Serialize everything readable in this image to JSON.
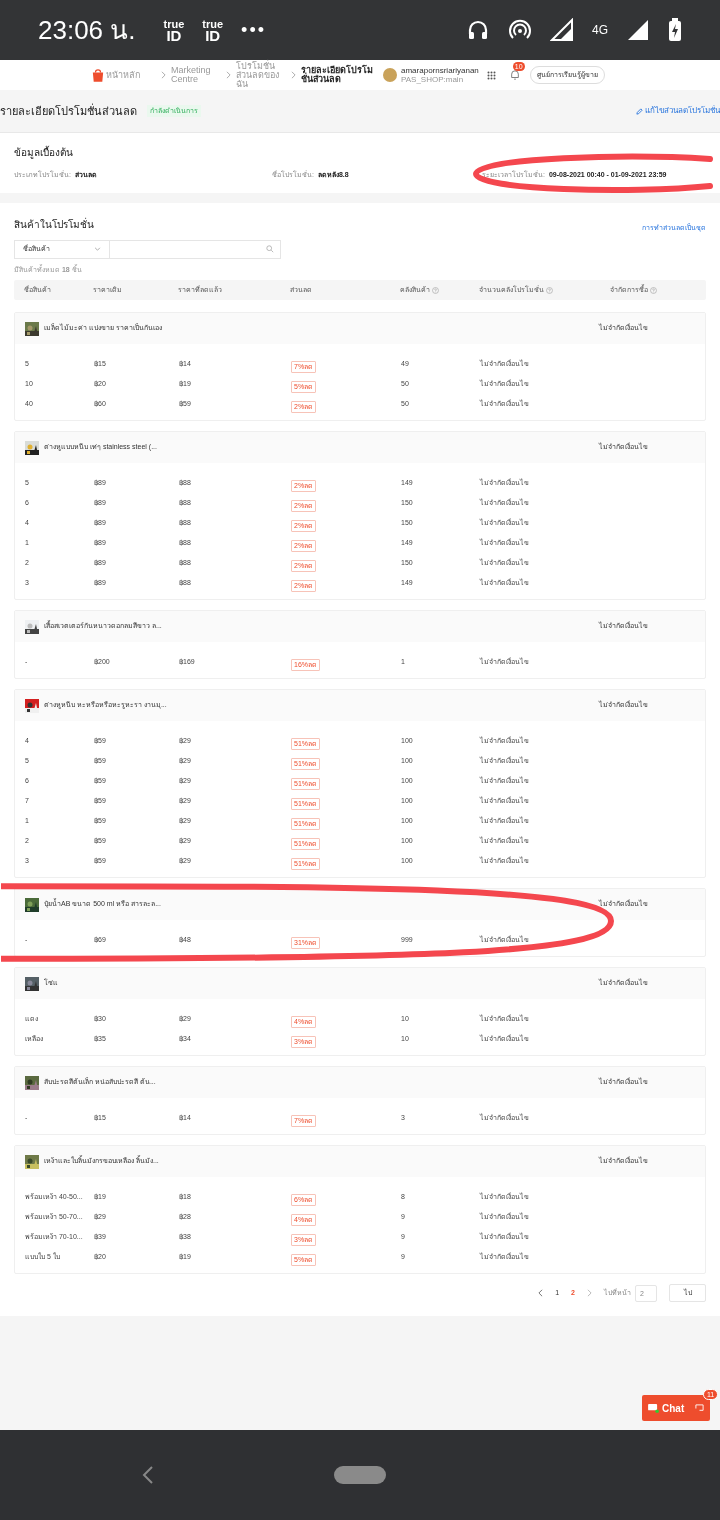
{
  "status_bar": {
    "time": "23:06 น.",
    "apps": [
      {
        "top": "true",
        "bottom": "ID"
      },
      {
        "top": "true",
        "bottom": "ID"
      }
    ],
    "more": "•••",
    "network": "4G"
  },
  "header": {
    "breadcrumbs": [
      {
        "label": "หน้าหลัก",
        "current": false
      },
      {
        "label": "Marketing Centre",
        "current": false
      },
      {
        "label": "โปรโมชั่นส่วนลดของฉัน",
        "current": false
      },
      {
        "label": "รายละเอียดโปรโมชั่นส่วนลด",
        "current": true
      }
    ],
    "user": "amarapornsriariyanan",
    "shop": "PAS_SHOP:main",
    "notifications": "10",
    "learning_button": "ศูนย์การเรียนรู้ผู้ขาย"
  },
  "title_bar": {
    "title": "รายละเอียดโปรโมชั่นส่วนลด",
    "status": "กำลังดำเนินการ",
    "edit_link": "แก้ไขส่วนลดโปรโมชั่น"
  },
  "basic_info": {
    "title": "ข้อมูลเบื้องต้น",
    "fields": [
      {
        "label": "ประเภทโปรโมชั่น:",
        "value": "ส่วนลด"
      },
      {
        "label": "ชื่อโปรโมชั่น:",
        "value": "ลดหลัง8.8"
      },
      {
        "label": "ระยะเวลาโปรโมชั่น:",
        "value": "09-08-2021 00:40 - 01-09-2021 23:59"
      }
    ]
  },
  "products": {
    "title": "สินค้าในโปรโมชั่น",
    "bundle_link": "การทำส่วนลดเป็นชุด",
    "filter": "ชื่อสินค้า",
    "count": "มีสินค้าทั้งหมด **18** ชิ้น",
    "columns": [
      {
        "label": "ชื่อสินค้า",
        "help": false
      },
      {
        "label": "ราคาเดิม",
        "help": false
      },
      {
        "label": "ราคาที่ลดแล้ว",
        "help": false
      },
      {
        "label": "ส่วนลด",
        "help": false
      },
      {
        "label": "คลังสินค้า",
        "help": true
      },
      {
        "label": "จำนวนคลังโปรโมชั่น",
        "help": true
      },
      {
        "label": "จำกัดการซื้อ",
        "help": true
      }
    ],
    "groups": [
      {
        "name": "เมล็ดไม้มะค่า แปงขาย ราคาเป็นกันเอง",
        "limit": "ไม่จำกัดเงื่อนไข",
        "rows": [
          [
            "5",
            "฿15",
            "฿14",
            "7%ลด",
            "49",
            "ไม่จำกัดเงื่อนไข"
          ],
          [
            "10",
            "฿20",
            "฿19",
            "5%ลด",
            "50",
            "ไม่จำกัดเงื่อนไข"
          ],
          [
            "40",
            "฿60",
            "฿59",
            "2%ลด",
            "50",
            "ไม่จำกัดเงื่อนไข"
          ]
        ]
      },
      {
        "name": "ต่างหูแบบหนีบ เท่ๆ stainless steel (...",
        "limit": "ไม่จำกัดเงื่อนไข",
        "rows": [
          [
            "5",
            "฿89",
            "฿88",
            "2%ลด",
            "149",
            "ไม่จำกัดเงื่อนไข"
          ],
          [
            "6",
            "฿89",
            "฿88",
            "2%ลด",
            "150",
            "ไม่จำกัดเงื่อนไข"
          ],
          [
            "4",
            "฿89",
            "฿88",
            "2%ลด",
            "150",
            "ไม่จำกัดเงื่อนไข"
          ],
          [
            "1",
            "฿89",
            "฿88",
            "2%ลด",
            "149",
            "ไม่จำกัดเงื่อนไข"
          ],
          [
            "2",
            "฿89",
            "฿88",
            "2%ลด",
            "150",
            "ไม่จำกัดเงื่อนไข"
          ],
          [
            "3",
            "฿89",
            "฿88",
            "2%ลด",
            "149",
            "ไม่จำกัดเงื่อนไข"
          ]
        ]
      },
      {
        "name": "เสื้อสเวตเตอร์กันหนาวดอกลมสีขาว ล...",
        "limit": "ไม่จำกัดเงื่อนไข",
        "rows": [
          [
            "-",
            "฿200",
            "฿169",
            "16%ลด",
            "1",
            "ไม่จำกัดเงื่อนไข"
          ]
        ]
      },
      {
        "name": "ต่างหูหนีบ หะหรือหรือหะรูหะรา งานมุ...",
        "limit": "ไม่จำกัดเงื่อนไข",
        "rows": [
          [
            "4",
            "฿59",
            "฿29",
            "51%ลด",
            "100",
            "ไม่จำกัดเงื่อนไข"
          ],
          [
            "5",
            "฿59",
            "฿29",
            "51%ลด",
            "100",
            "ไม่จำกัดเงื่อนไข"
          ],
          [
            "6",
            "฿59",
            "฿29",
            "51%ลด",
            "100",
            "ไม่จำกัดเงื่อนไข"
          ],
          [
            "7",
            "฿59",
            "฿29",
            "51%ลด",
            "100",
            "ไม่จำกัดเงื่อนไข"
          ],
          [
            "1",
            "฿59",
            "฿29",
            "51%ลด",
            "100",
            "ไม่จำกัดเงื่อนไข"
          ],
          [
            "2",
            "฿59",
            "฿29",
            "51%ลด",
            "100",
            "ไม่จำกัดเงื่อนไข"
          ],
          [
            "3",
            "฿59",
            "฿29",
            "51%ลด",
            "100",
            "ไม่จำกัดเงื่อนไข"
          ]
        ]
      },
      {
        "name": "ปุ๋ยน้ำAB ขนาด 500 ml หรือ สารละล...",
        "limit": "ไม่จำกัดเงื่อนไข",
        "rows": [
          [
            "-",
            "฿69",
            "฿48",
            "31%ลด",
            "999",
            "ไม่จำกัดเงื่อนไข"
          ]
        ]
      },
      {
        "name": "โซ่แ",
        "limit": "ไม่จำกัดเงื่อนไข",
        "rows": [
          [
            "แดง",
            "฿30",
            "฿29",
            "4%ลด",
            "10",
            "ไม่จำกัดเงื่อนไข"
          ],
          [
            "เหลือง",
            "฿35",
            "฿34",
            "3%ลด",
            "10",
            "ไม่จำกัดเงื่อนไข"
          ]
        ]
      },
      {
        "name": "สับปะรดสีต้นเล็ก หน่อสับปะรดสี ต้น...",
        "limit": "ไม่จำกัดเงื่อนไข",
        "rows": [
          [
            "-",
            "฿15",
            "฿14",
            "7%ลด",
            "3",
            "ไม่จำกัดเงื่อนไข"
          ]
        ]
      },
      {
        "name": "เหง้าและใบลิ้นมังกรขอบเหลือง ลิ้นมัง...",
        "limit": "ไม่จำกัดเงื่อนไข",
        "rows": [
          [
            "พร้อมเหง้า 40-50...",
            "฿19",
            "฿18",
            "6%ลด",
            "8",
            "ไม่จำกัดเงื่อนไข"
          ],
          [
            "พร้อมเหง้า 50-70...",
            "฿29",
            "฿28",
            "4%ลด",
            "9",
            "ไม่จำกัดเงื่อนไข"
          ],
          [
            "พร้อมเหง้า 70-10...",
            "฿39",
            "฿38",
            "3%ลด",
            "9",
            "ไม่จำกัดเงื่อนไข"
          ],
          [
            "แบบใบ 5 ใบ",
            "฿20",
            "฿19",
            "5%ลด",
            "9",
            "ไม่จำกัดเงื่อนไข"
          ]
        ]
      }
    ]
  },
  "pagination": {
    "pages": [
      {
        "label": "1",
        "selected": false
      },
      {
        "label": "2",
        "selected": true
      }
    ],
    "goto_label": "ไปที่หน้า",
    "goto_placeholder": "2",
    "go_button": "ไป"
  },
  "chat": {
    "label": "Chat",
    "badge": "11"
  }
}
